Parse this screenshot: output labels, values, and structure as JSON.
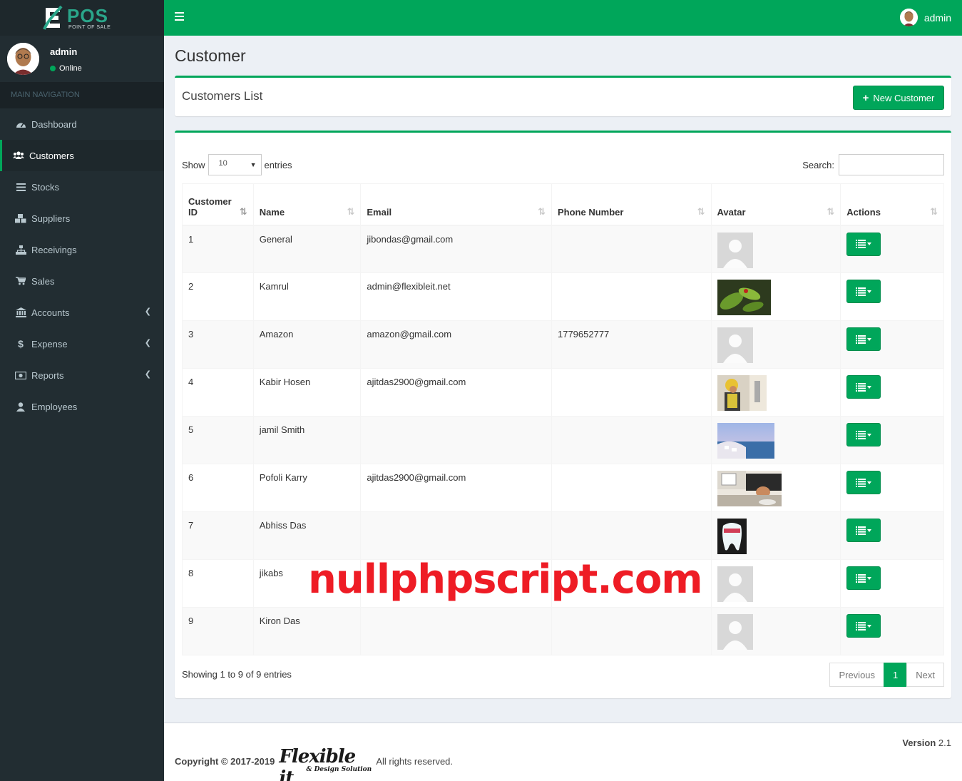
{
  "app": {
    "logo_text": "POS",
    "logo_sub": "POINT OF SALE"
  },
  "user_panel": {
    "name": "admin",
    "status": "Online"
  },
  "sidebar": {
    "header": "MAIN NAVIGATION",
    "items": [
      {
        "label": "Dashboard",
        "icon": "dashboard-icon"
      },
      {
        "label": "Customers",
        "icon": "users-icon",
        "active": true
      },
      {
        "label": "Stocks",
        "icon": "list-icon"
      },
      {
        "label": "Suppliers",
        "icon": "cubes-icon"
      },
      {
        "label": "Receivings",
        "icon": "sitemap-icon"
      },
      {
        "label": "Sales",
        "icon": "cart-icon"
      },
      {
        "label": "Accounts",
        "icon": "bank-icon",
        "submenu": true
      },
      {
        "label": "Expense",
        "icon": "dollar-icon",
        "submenu": true
      },
      {
        "label": "Reports",
        "icon": "money-icon",
        "submenu": true
      },
      {
        "label": "Employees",
        "icon": "user-icon"
      }
    ]
  },
  "topbar": {
    "user": "admin"
  },
  "page": {
    "title": "Customer",
    "list_title": "Customers List",
    "new_button": "New Customer"
  },
  "table_controls": {
    "show_label": "Show",
    "entries_label": "entries",
    "page_length": "10",
    "search_label": "Search:"
  },
  "table": {
    "columns": [
      "Customer ID",
      "Name",
      "Email",
      "Phone Number",
      "Avatar",
      "Actions"
    ],
    "rows": [
      {
        "id": "1",
        "name": "General",
        "email": "jibondas@gmail.com",
        "phone": "",
        "avatar": "default"
      },
      {
        "id": "2",
        "name": "Kamrul",
        "email": "admin@flexibleit.net",
        "phone": "",
        "avatar": "plant-photo"
      },
      {
        "id": "3",
        "name": "Amazon",
        "email": "amazon@gmail.com",
        "phone": "1779652777",
        "avatar": "default"
      },
      {
        "id": "4",
        "name": "Kabir Hosen",
        "email": "ajitdas2900@gmail.com",
        "phone": "",
        "avatar": "worker-photo"
      },
      {
        "id": "5",
        "name": "jamil Smith",
        "email": "",
        "phone": "",
        "avatar": "coast-photo"
      },
      {
        "id": "6",
        "name": "Pofoli Karry",
        "email": "ajitdas2900@gmail.com",
        "phone": "",
        "avatar": "desk-photo"
      },
      {
        "id": "7",
        "name": "Abhiss Das",
        "email": "",
        "phone": "",
        "avatar": "tooth-photo"
      },
      {
        "id": "8",
        "name": "jikabs",
        "email": "",
        "phone": "",
        "avatar": "default"
      },
      {
        "id": "9",
        "name": "Kiron Das",
        "email": "",
        "phone": "",
        "avatar": "default"
      }
    ]
  },
  "pagination": {
    "info": "Showing 1 to 9 of 9 entries",
    "previous": "Previous",
    "current": "1",
    "next": "Next"
  },
  "watermark": "nullphpscript.com",
  "footer": {
    "copyright": "Copyright © 2017-2019",
    "brand": "Flexible it",
    "brand_sub": "& Design Solution",
    "rights": "All rights reserved.",
    "version_label": "Version",
    "version": "2.1"
  },
  "colors": {
    "accent": "#00a65a",
    "sidebar": "#222d32",
    "watermark": "#ee1c25"
  }
}
